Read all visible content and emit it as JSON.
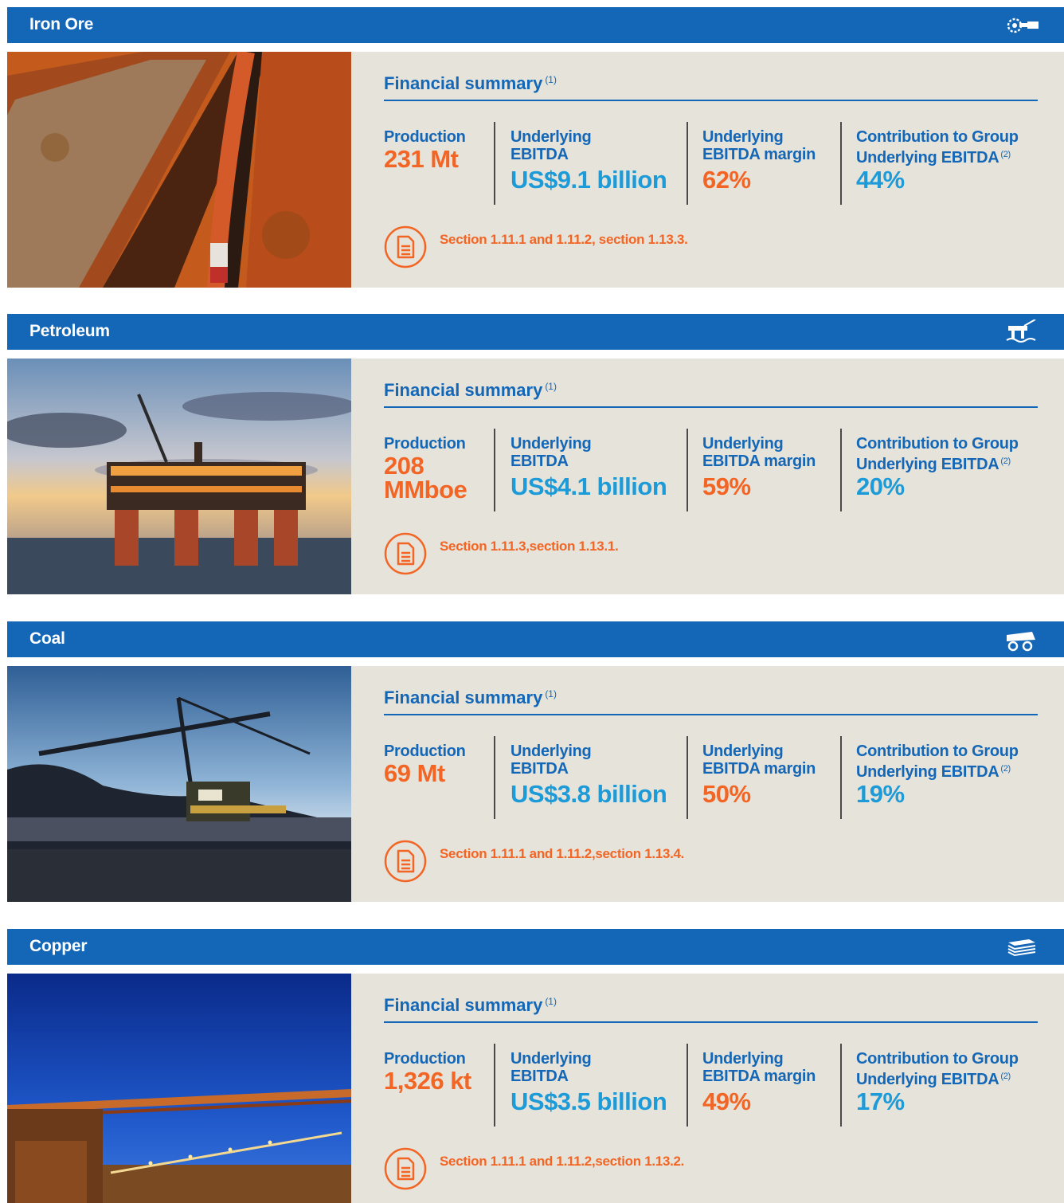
{
  "sections": [
    {
      "title": "Iron Ore",
      "icon": "bucket-wheel-icon",
      "financial_summary": "Financial summary",
      "footnote_1": "(1)",
      "production_label": "Production",
      "production_value": "231 Mt",
      "ebitda_label": "Underlying EBITDA",
      "ebitda_value": "US$9.1 billion",
      "margin_label": "Underlying EBITDA margin",
      "margin_value": "62%",
      "contribution_label": "Contribution to Group Underlying EBITDA",
      "footnote_2": "(2)",
      "contribution_value": "44%",
      "reference": "Section 1.11.1 and 1.11.2, section 1.13.3."
    },
    {
      "title": "Petroleum",
      "icon": "oil-platform-icon",
      "financial_summary": "Financial summary",
      "footnote_1": "(1)",
      "production_label": "Production",
      "production_value": "208 MMboe",
      "ebitda_label": "Underlying EBITDA",
      "ebitda_value": "US$4.1 billion",
      "margin_label": "Underlying EBITDA margin",
      "margin_value": "59%",
      "contribution_label": "Contribution to Group Underlying EBITDA",
      "footnote_2": "(2)",
      "contribution_value": "20%",
      "reference": "Section 1.11.3,section 1.13.1."
    },
    {
      "title": "Coal",
      "icon": "mining-truck-icon",
      "financial_summary": "Financial summary",
      "footnote_1": "(1)",
      "production_label": "Production",
      "production_value": "69 Mt",
      "ebitda_label": "Underlying EBITDA",
      "ebitda_value": "US$3.8 billion",
      "margin_label": "Underlying EBITDA margin",
      "margin_value": "50%",
      "contribution_label": "Contribution to Group Underlying EBITDA",
      "footnote_2": "(2)",
      "contribution_value": "19%",
      "reference": "Section 1.11.1 and 1.11.2,section 1.13.4."
    },
    {
      "title": "Copper",
      "icon": "copper-cathode-stack-icon",
      "financial_summary": "Financial summary",
      "footnote_1": "(1)",
      "production_label": "Production",
      "production_value": "1,326 kt",
      "ebitda_label": "Underlying EBITDA",
      "ebitda_value": "US$3.5 billion",
      "margin_label": "Underlying EBITDA margin",
      "margin_value": "49%",
      "contribution_label": "Contribution to Group Underlying EBITDA",
      "footnote_2": "(2)",
      "contribution_value": "17%",
      "reference": "Section 1.11.1 and 1.11.2,section 1.13.2."
    }
  ],
  "colors": {
    "header_blue": "#1467b7",
    "panel_beige": "#e6e3da",
    "accent_orange": "#f26524",
    "accent_cyan": "#1d9ad8"
  }
}
